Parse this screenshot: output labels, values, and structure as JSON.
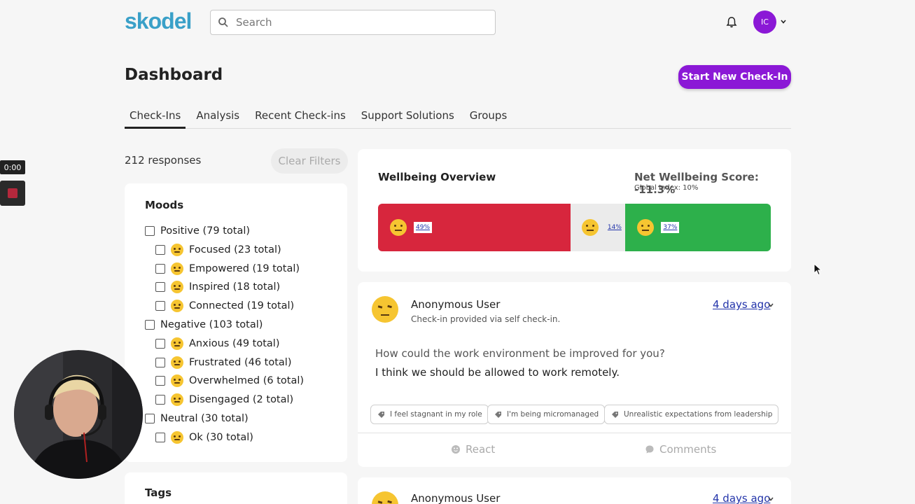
{
  "header": {
    "logo": "skodel",
    "search_placeholder": "Search",
    "avatar_initials": "IC"
  },
  "page": {
    "title": "Dashboard",
    "new_checkin_label": "Start New Check-In"
  },
  "tabs": [
    {
      "label": "Check-Ins",
      "active": true
    },
    {
      "label": "Analysis",
      "active": false
    },
    {
      "label": "Recent Check-ins",
      "active": false
    },
    {
      "label": "Support Solutions",
      "active": false
    },
    {
      "label": "Groups",
      "active": false
    }
  ],
  "filters": {
    "responses": "212 responses",
    "clear_label": "Clear Filters"
  },
  "moods": {
    "title": "Moods",
    "items": [
      {
        "label": "Positive (79 total)",
        "group": true
      },
      {
        "label": "Focused (23 total)",
        "group": false
      },
      {
        "label": "Empowered (19 total)",
        "group": false
      },
      {
        "label": "Inspired (18 total)",
        "group": false
      },
      {
        "label": "Connected (19 total)",
        "group": false
      },
      {
        "label": "Negative (103 total)",
        "group": true
      },
      {
        "label": "Anxious (49 total)",
        "group": false
      },
      {
        "label": "Frustrated (46 total)",
        "group": false
      },
      {
        "label": "Overwhelmed (6 total)",
        "group": false
      },
      {
        "label": "Disengaged (2 total)",
        "group": false
      },
      {
        "label": "Neutral (30 total)",
        "group": true
      },
      {
        "label": "Ok (30 total)",
        "group": false
      }
    ]
  },
  "tags": {
    "title": "Tags"
  },
  "wellbeing": {
    "title": "Wellbeing Overview",
    "score": "Net Wellbeing Score: -11.3%",
    "index": "Global Index: 10%",
    "segments": [
      {
        "key": "negative",
        "pct_label": "49%",
        "share": 0.49,
        "color": "#d7263d"
      },
      {
        "key": "neutral",
        "pct_label": "14%",
        "share": 0.14,
        "color": "#ebebeb"
      },
      {
        "key": "positive",
        "pct_label": "37%",
        "share": 0.37,
        "color": "#2db04b"
      }
    ]
  },
  "post": {
    "user": "Anonymous User",
    "subtitle": "Check-in provided via self check-in.",
    "time": "4 days ago",
    "question": "How could the work environment be improved for you?",
    "answer": "I think we should be allowed to work remotely.",
    "tags": [
      "I feel stagnant in my role",
      "I'm being micromanaged",
      "Unrealistic expectations from leadership"
    ],
    "react_label": "React",
    "comments_label": "Comments"
  },
  "post2": {
    "user": "Anonymous User",
    "time": "4 days ago"
  },
  "recording": {
    "timer": "0:00"
  },
  "colors": {
    "accent": "#8b18d6",
    "brand": "#3aa0c8",
    "link": "#2233aa"
  }
}
